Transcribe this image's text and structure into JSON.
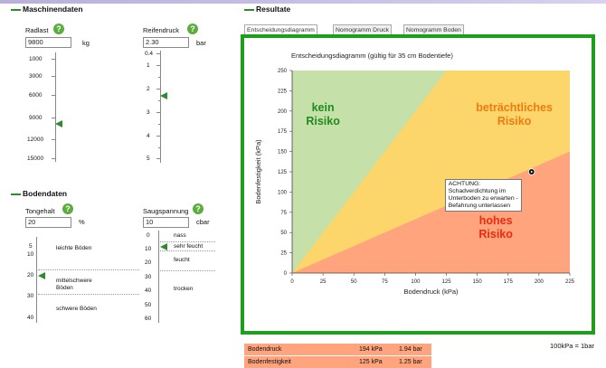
{
  "machine": {
    "title": "Maschinendaten",
    "radlast": {
      "label": "Radlast",
      "value": "9800",
      "unit": "kg",
      "ticks": [
        "1000",
        "3000",
        "6000",
        "9000",
        "12000",
        "15000"
      ]
    },
    "reifendruck": {
      "label": "Reifendruck",
      "value": "2.30",
      "unit": "bar",
      "ticks": [
        "0.4",
        "1",
        "2",
        "3",
        "4",
        "5"
      ]
    }
  },
  "soil": {
    "title": "Bodendaten",
    "tongehalt": {
      "label": "Tongehalt",
      "value": "20",
      "unit": "%",
      "ticks": [
        "5",
        "10",
        "20",
        "30",
        "40"
      ],
      "categories": [
        "leichte Böden",
        "mittelschwere\nBöden",
        "schwere Böden"
      ]
    },
    "saugspannung": {
      "label": "Saugspannung",
      "value": "10",
      "unit": "cbar",
      "ticks": [
        "0",
        "10",
        "20",
        "30",
        "40",
        "50",
        "60"
      ],
      "categories": [
        "nass",
        "sehr feucht",
        "feucht",
        "trocken"
      ]
    }
  },
  "help_glyph": "?",
  "results": {
    "title": "Resultate",
    "tabs": [
      "Entscheidungsdiagramm",
      "Nomogramm Druck",
      "Nomogramm Boden"
    ],
    "active_tab": 0,
    "footnote": "100kPa = 1bar",
    "table": [
      {
        "label": "Bodendruck",
        "kpa": "194 kPa",
        "bar": "1.94 bar"
      },
      {
        "label": "Bodenfestigkeit",
        "kpa": "125 kPa",
        "bar": "1.25 bar"
      }
    ]
  },
  "chart_data": {
    "type": "area",
    "title": "Entscheidungsdiagramm",
    "subtitle": "(gültig für 35 cm Bodentiefe)",
    "xlabel": "Bodendruck (kPa)",
    "ylabel": "Bodenfestigkeit (kPa)",
    "xlim": [
      0,
      225
    ],
    "ylim": [
      0,
      250
    ],
    "xticks": [
      0,
      25,
      50,
      75,
      100,
      125,
      150,
      175,
      200,
      225
    ],
    "yticks": [
      0,
      25,
      50,
      75,
      100,
      125,
      150,
      175,
      200,
      225,
      250
    ],
    "grid": false,
    "zones": [
      {
        "label": "kein Risiko",
        "lines": [
          "kein",
          "Risiko"
        ],
        "color": "#c5e0a8",
        "text_color": "#1e8c1e",
        "boundary": [
          [
            0,
            0
          ],
          [
            0,
            250
          ],
          [
            225,
            250
          ],
          [
            225,
            250
          ]
        ],
        "label_at": [
          25,
          200
        ]
      },
      {
        "label": "beträchtliches Risiko",
        "lines": [
          "beträchtliches",
          "Risiko"
        ],
        "color": "#fcd66a",
        "text_color": "#f07a10",
        "label_at": [
          180,
          200
        ]
      },
      {
        "label": "hohes Risiko",
        "lines": [
          "hohes",
          "Risiko"
        ],
        "color": "#ffa47c",
        "text_color": "#ee2a0e",
        "label_at": [
          165,
          60
        ]
      }
    ],
    "boundaries": {
      "kein_upper": [
        [
          0,
          0
        ],
        [
          125,
          250
        ]
      ],
      "hohes_lower": [
        [
          0,
          0
        ],
        [
          225,
          150
        ]
      ]
    },
    "point": {
      "x": 194,
      "y": 125
    },
    "annotation": "ACHTUNG:\nSchadverdichtung im\nUnterboden zu erwarten -\nBefahrung unterlassen",
    "colors": {
      "accent": "#1ca01c",
      "axis": "#444444"
    }
  }
}
